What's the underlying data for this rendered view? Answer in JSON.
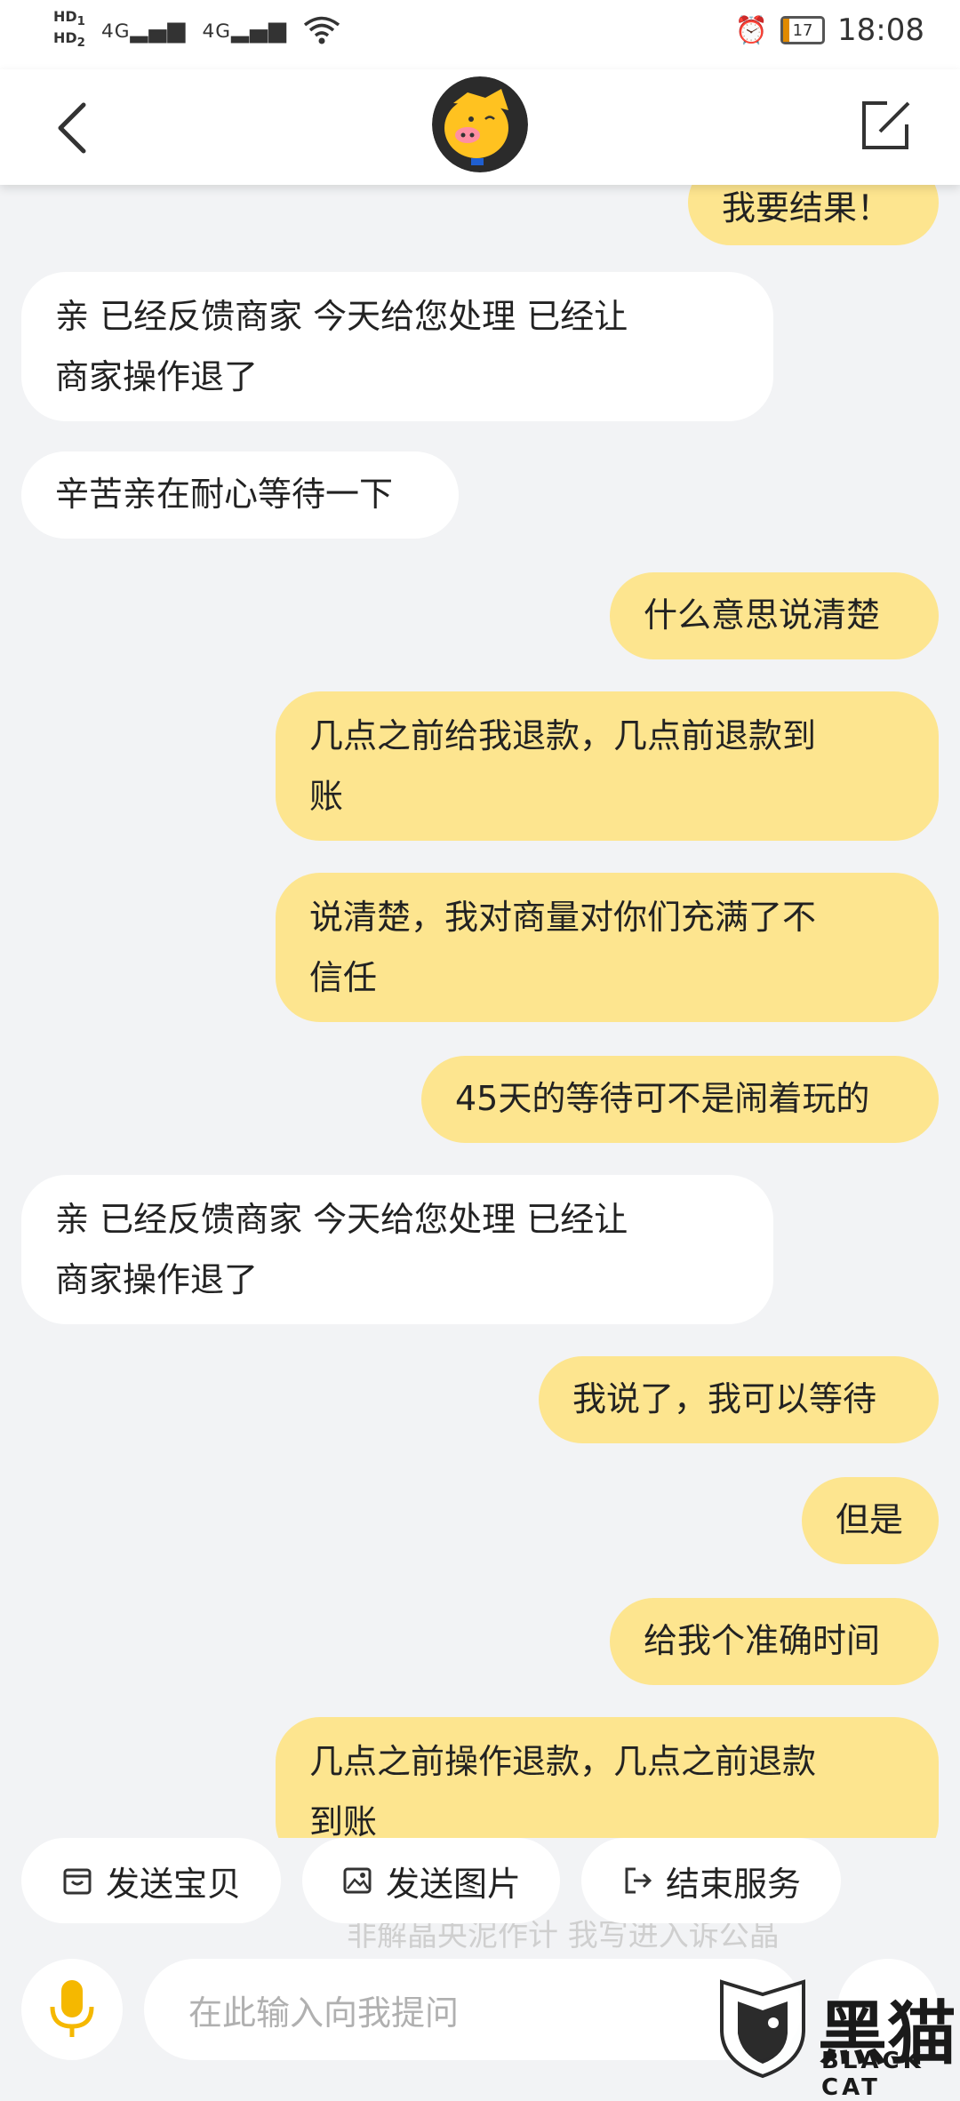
{
  "status_bar": {
    "sim1_label": "HD",
    "sim1_index": "1",
    "sim2_label": "HD",
    "sim2_index": "2",
    "network1": "4G",
    "network2": "4G",
    "battery_level": "17",
    "battery_fraction": 0.17,
    "battery_color": "#e08a00",
    "time": "18:08",
    "icons": [
      "alarm-icon",
      "battery-icon",
      "wifi-icon",
      "signal-icon"
    ]
  },
  "header": {
    "back_icon": "chevron-left-icon",
    "avatar": "pig-mascot-avatar",
    "edit_icon": "edit-icon"
  },
  "messages": [
    {
      "side": "me",
      "text": "我要结果！"
    },
    {
      "side": "them",
      "lines": [
        "亲 已经反馈商家  今天给您处理   已经让",
        "商家操作退了"
      ]
    },
    {
      "side": "them",
      "text": "辛苦亲在耐心等待一下"
    },
    {
      "side": "me",
      "text": "什么意思说清楚"
    },
    {
      "side": "me",
      "lines": [
        "几点之前给我退款，几点前退款到",
        "账"
      ]
    },
    {
      "side": "me",
      "lines": [
        "说清楚，我对商量对你们充满了不",
        "信任"
      ]
    },
    {
      "side": "me",
      "text": "45天的等待可不是闹着玩的"
    },
    {
      "side": "them",
      "lines": [
        "亲 已经反馈商家  今天给您处理   已经让",
        "商家操作退了"
      ]
    },
    {
      "side": "me",
      "text": "我说了，我可以等待"
    },
    {
      "side": "me",
      "text": "但是"
    },
    {
      "side": "me",
      "text": "给我个准确时间"
    },
    {
      "side": "me",
      "lines": [
        "几点之前操作退款，几点之前退款",
        "到账"
      ]
    }
  ],
  "quick_actions": [
    {
      "label": "发送宝贝",
      "icon": "product-box-icon"
    },
    {
      "label": "发送图片",
      "icon": "image-icon"
    },
    {
      "label": "结束服务",
      "icon": "exit-icon"
    }
  ],
  "ghost_text": "非解晶央泥作计    我写进入诉公晶",
  "input": {
    "placeholder": "在此输入向我提问",
    "mic_icon": "microphone-icon",
    "plus_icon": "plus-icon"
  },
  "watermark": {
    "brand": "黑猫",
    "brand_en": "BLACK CAT"
  },
  "colors": {
    "my_bubble": "#fde58f",
    "their_bubble": "#ffffff",
    "background": "#f2f3f5",
    "mic": "#f5b800"
  }
}
